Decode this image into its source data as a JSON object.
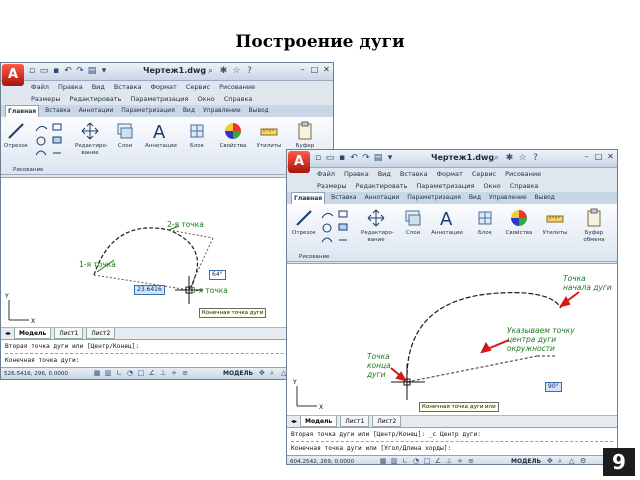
{
  "slide": {
    "title": "Построение дуги",
    "page_number": "9"
  },
  "window1": {
    "app_letter": "A",
    "doc_title": "Чертеж1.dwg",
    "menu_row1": [
      "Файл",
      "Правка",
      "Вид",
      "Вставка",
      "Формат",
      "Сервис",
      "Рисование"
    ],
    "menu_row2": [
      "Размеры",
      "Редактировать",
      "Параметризация",
      "Окно",
      "Справка"
    ],
    "ribbon_tabs": [
      "Главная",
      "Вставка",
      "Аннотации",
      "Параметризация",
      "Вид",
      "Управление",
      "Вывод"
    ],
    "ribbon_buttons": [
      "Отрезок",
      "Редактиро-вание",
      "Слои",
      "Аннотации",
      "Блок",
      "Свойства",
      "Утилиты",
      "Буфер"
    ],
    "panel_label": "Рисование",
    "annotations": {
      "point2": "2-я точка",
      "point1": "1-я точка",
      "point3": "3-я точка"
    },
    "value_box_left": "23.6416",
    "value_box_right": "64°",
    "tooltip": "Конечная точка дуги",
    "layout_tabs": [
      "Модель",
      "Лист1",
      "Лист2"
    ],
    "cmd_lines": [
      "Вторая точка дуги или [Центр/Конец]:",
      "Конечная точка дуги:"
    ],
    "coords": "526.5416, 296, 0.0000",
    "model_label": "МОДЕЛЬ"
  },
  "window2": {
    "app_letter": "A",
    "doc_title": "Чертеж1.dwg",
    "menu_row1": [
      "Файл",
      "Правка",
      "Вид",
      "Вставка",
      "Формат",
      "Сервис",
      "Рисование"
    ],
    "menu_row2": [
      "Размеры",
      "Редактировать",
      "Параметризация",
      "Окно",
      "Справка"
    ],
    "ribbon_tabs": [
      "Главная",
      "Вставка",
      "Аннотации",
      "Параметризация",
      "Вид",
      "Управление",
      "Вывод"
    ],
    "ribbon_buttons": [
      "Отрезок",
      "Редактиро-вание",
      "Слои",
      "Аннотации",
      "Блок",
      "Свойства",
      "Утилиты",
      "Буфер обмена"
    ],
    "panel_label": "Рисование",
    "annotations": {
      "start_point": "Точка начала дуги",
      "center_point": "Указываем точку центра дуги окружности",
      "end_point": "Точка конца дуги"
    },
    "value_box": "90°",
    "tooltip": "Конечная точка дуги или",
    "layout_tabs": [
      "Модель",
      "Лист1",
      "Лист2"
    ],
    "cmd_lines": [
      "Вторая точка дуги или [Центр/Конец]: _с Центр дуги:",
      "Конечная точка дуги или [Угол/Длина хорды]:"
    ],
    "coords": "604.2542, 269, 0.0000",
    "model_label": "МОДЕЛЬ"
  },
  "colors": {
    "annotation_green": "#1f7a1f",
    "arrow_red": "#d11a1a",
    "app_red": "#c81e12"
  }
}
